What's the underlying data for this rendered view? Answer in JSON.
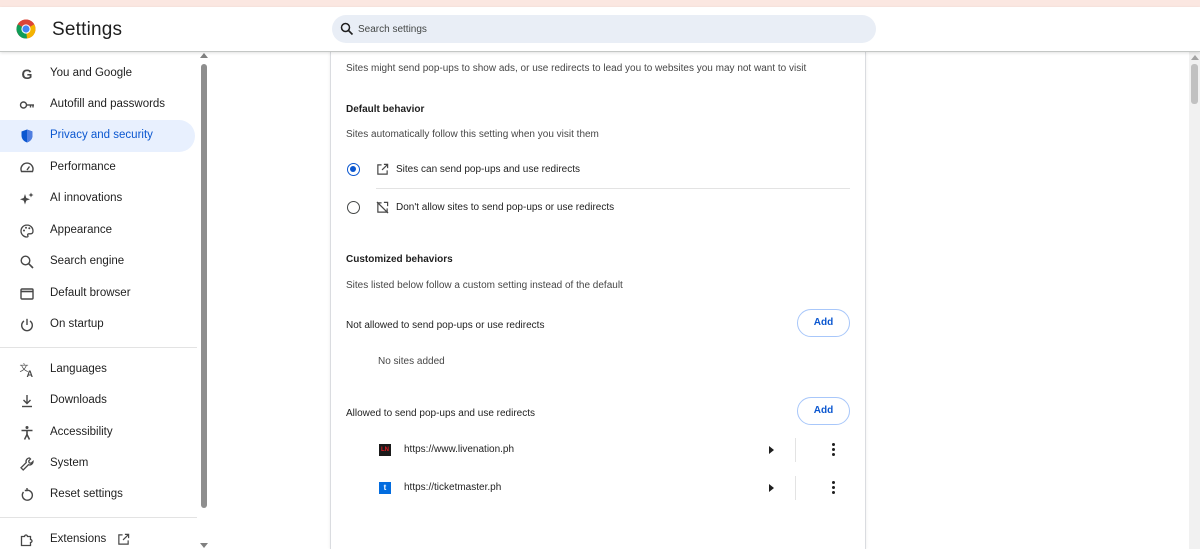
{
  "window": {
    "title": "Settings",
    "top_strip_color": "#fbe7e1"
  },
  "search": {
    "placeholder": "Search settings"
  },
  "sidebar": {
    "items": [
      {
        "label": "You and Google",
        "icon": "google-g-icon"
      },
      {
        "label": "Autofill and passwords",
        "icon": "key-icon"
      },
      {
        "label": "Privacy and security",
        "icon": "shield-icon",
        "active": true
      },
      {
        "label": "Performance",
        "icon": "speedometer-icon"
      },
      {
        "label": "AI innovations",
        "icon": "sparkle-icon"
      },
      {
        "label": "Appearance",
        "icon": "palette-icon"
      },
      {
        "label": "Search engine",
        "icon": "search-icon"
      },
      {
        "label": "Default browser",
        "icon": "browser-window-icon"
      },
      {
        "label": "On startup",
        "icon": "power-icon"
      },
      {
        "label": "Languages",
        "icon": "translate-icon"
      },
      {
        "label": "Downloads",
        "icon": "download-icon"
      },
      {
        "label": "Accessibility",
        "icon": "accessibility-icon"
      },
      {
        "label": "System",
        "icon": "wrench-icon"
      },
      {
        "label": "Reset settings",
        "icon": "reset-icon"
      },
      {
        "label": "Extensions",
        "icon": "puzzle-icon"
      }
    ],
    "active_color": "#0b57d0",
    "active_bg": "#e8f0fe"
  },
  "content": {
    "intro": "Sites might send pop-ups to show ads, or use redirects to lead you to websites you may not want to visit",
    "default_behavior": {
      "heading": "Default behavior",
      "description": "Sites automatically follow this setting when you visit them",
      "options": [
        {
          "label": "Sites can send pop-ups and use redirects",
          "selected": true,
          "icon": "open-in-new-icon"
        },
        {
          "label": "Don't allow sites to send pop-ups or use redirects",
          "selected": false,
          "icon": "popup-blocked-icon"
        }
      ]
    },
    "customized": {
      "heading": "Customized behaviors",
      "description": "Sites listed below follow a custom setting instead of the default",
      "not_allowed": {
        "label": "Not allowed to send pop-ups or use redirects",
        "add_label": "Add",
        "empty_text": "No sites added"
      },
      "allowed": {
        "label": "Allowed to send pop-ups and use redirects",
        "add_label": "Add",
        "sites": [
          {
            "url": "https://www.livenation.ph",
            "favicon_text": "LN",
            "favicon_bg": "#1a1a1a",
            "favicon_fg": "#e31b23"
          },
          {
            "url": "https://ticketmaster.ph",
            "favicon_text": "t",
            "favicon_bg": "#026cdf",
            "favicon_fg": "#ffffff"
          }
        ]
      }
    }
  }
}
